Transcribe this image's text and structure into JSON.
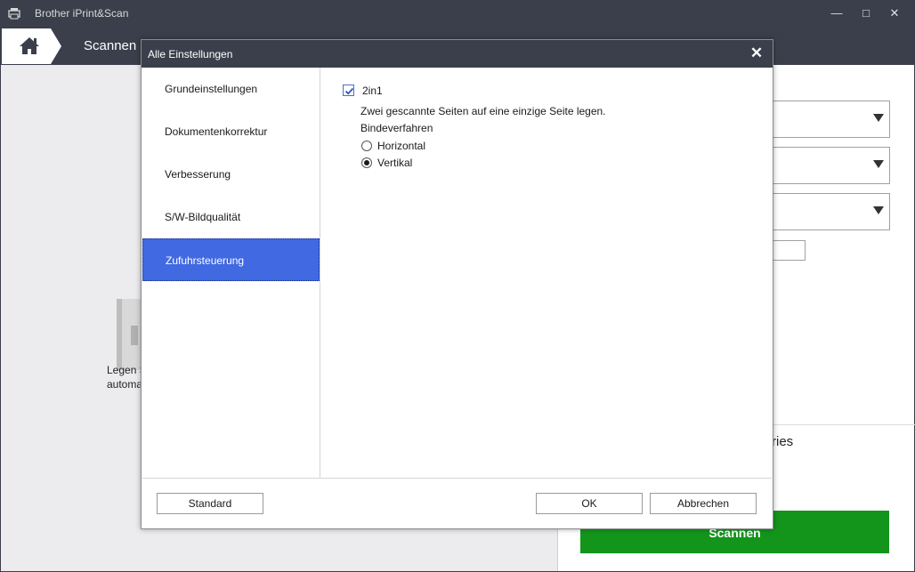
{
  "window": {
    "title": "Brother iPrint&Scan",
    "minimize": "—",
    "maximize": "□",
    "close": "✕"
  },
  "nav": {
    "title": "Scannen"
  },
  "left_pane": {
    "instruction_line1": "Legen S",
    "instruction_line2": "automa"
  },
  "right_pane": {
    "section_label": "ries",
    "scan_button": "Scannen"
  },
  "dialog": {
    "title": "Alle Einstellungen",
    "close": "✕",
    "categories": [
      {
        "label": "Grundeinstellungen",
        "selected": false
      },
      {
        "label": "Dokumentenkorrektur",
        "selected": false
      },
      {
        "label": "Verbesserung",
        "selected": false
      },
      {
        "label": "S/W-Bildqualität",
        "selected": false
      },
      {
        "label": "Zufuhrsteuerung",
        "selected": true
      }
    ],
    "settings": {
      "twoinone_label": "2in1",
      "twoinone_checked": true,
      "description": "Zwei gescannte Seiten auf eine einzige Seite legen.",
      "binding_label": "Bindeverfahren",
      "binding_options": [
        {
          "label": "Horizontal",
          "selected": false
        },
        {
          "label": "Vertikal",
          "selected": true
        }
      ]
    },
    "buttons": {
      "standard": "Standard",
      "ok": "OK",
      "cancel": "Abbrechen"
    }
  }
}
